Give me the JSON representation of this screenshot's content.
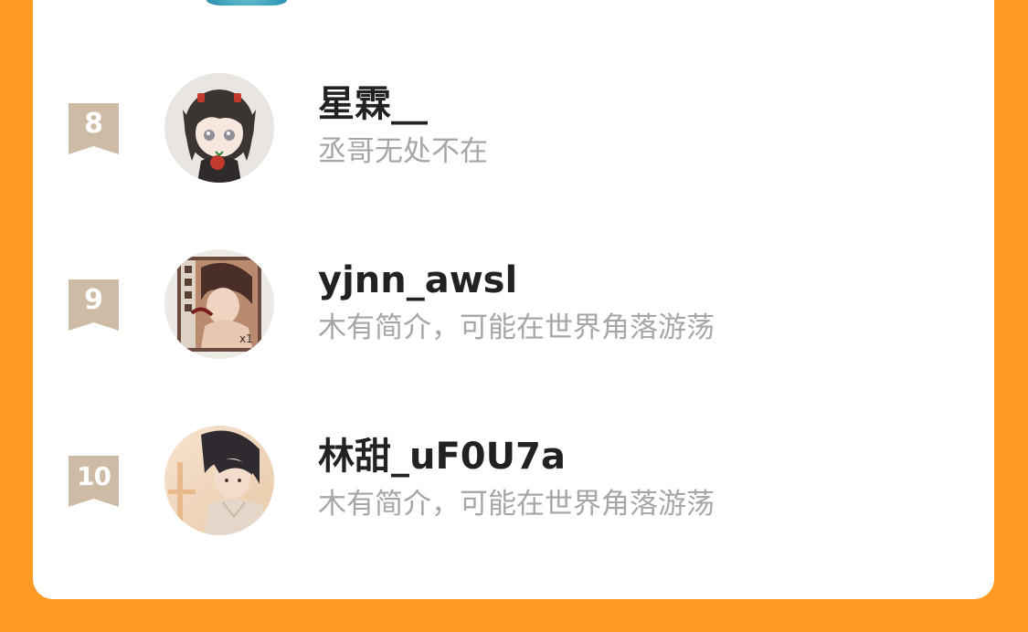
{
  "colors": {
    "page_background": "#FF9A24",
    "card_background": "#FFFFFF",
    "badge": "#CDBBA6",
    "name_text": "#222222",
    "bio_text": "#A6A6A6"
  },
  "ranking": [
    {
      "rank": "8",
      "name": "星霖__",
      "bio": "丞哥无处不在",
      "avatar_icon": "anime-girl-avatar-icon"
    },
    {
      "rank": "9",
      "name": "yjnn_awsl",
      "bio": "木有简介，可能在世界角落游荡",
      "avatar_icon": "card-art-avatar-icon"
    },
    {
      "rank": "10",
      "name": "林甜_uF0U7a",
      "bio": "木有简介，可能在世界角落游荡",
      "avatar_icon": "anime-boy-avatar-icon"
    }
  ]
}
